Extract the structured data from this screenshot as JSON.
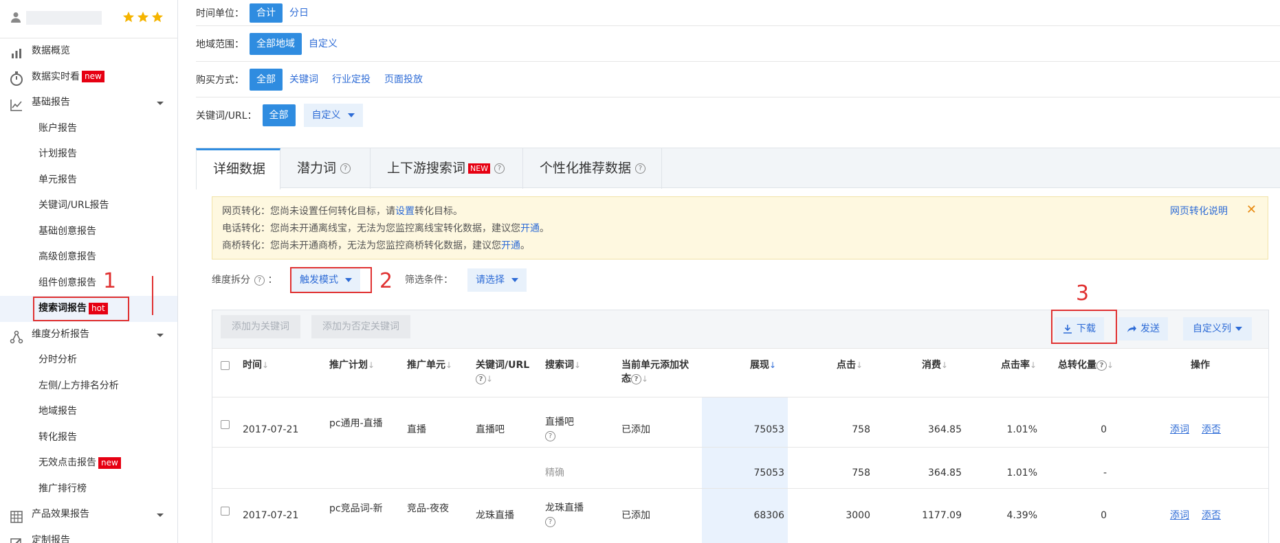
{
  "sidebar": {
    "stars": [
      "★",
      "★",
      "★"
    ],
    "items": [
      {
        "label": "数据概览",
        "icon": "bar-chart-icon"
      },
      {
        "label": "数据实时看",
        "icon": "stopwatch-icon",
        "tag": "new"
      },
      {
        "label": "基础报告",
        "icon": "line-chart-icon"
      },
      {
        "label": "账户报告"
      },
      {
        "label": "计划报告"
      },
      {
        "label": "单元报告"
      },
      {
        "label": "关键词/URL报告"
      },
      {
        "label": "基础创意报告"
      },
      {
        "label": "高级创意报告"
      },
      {
        "label": "组件创意报告"
      },
      {
        "label": "搜索词报告",
        "tag": "hot"
      },
      {
        "label": "维度分析报告",
        "icon": "network-icon"
      },
      {
        "label": "分时分析"
      },
      {
        "label": "左侧/上方排名分析"
      },
      {
        "label": "地域报告"
      },
      {
        "label": "转化报告"
      },
      {
        "label": "无效点击报告",
        "tag": "new"
      },
      {
        "label": "推广排行榜"
      },
      {
        "label": "产品效果报告",
        "icon": "grid-icon"
      },
      {
        "label": "定制报告",
        "icon": "edit-icon"
      }
    ]
  },
  "annotations": {
    "n1": "1",
    "n2": "2",
    "n3": "3"
  },
  "filters": {
    "time_label": "时间单位：",
    "time_opts": [
      "合计",
      "分日"
    ],
    "region_label": "地域范围：",
    "region_opts": [
      "全部地域",
      "自定义"
    ],
    "buy_label": "购买方式：",
    "buy_opts": [
      "全部",
      "关键词",
      "行业定投",
      "页面投放"
    ],
    "kw_label": "关键词/URL：",
    "kw_all": "全部",
    "kw_custom": "自定义"
  },
  "tabs": [
    {
      "label": "详细数据"
    },
    {
      "label": "潜力词"
    },
    {
      "label": "上下游搜索词",
      "tag": "NEW"
    },
    {
      "label": "个性化推荐数据"
    }
  ],
  "notice": {
    "line1_a": "网页转化：您尚未设置任何转化目标，请",
    "line1_link": "设置",
    "line1_b": "转化目标。",
    "line2_a": "电话转化：您尚未开通离线宝，无法为您监控离线宝转化数据，建议您",
    "line2_link": "开通",
    "line2_b": "。",
    "line3_a": "商桥转化：您尚未开通商桥，无法为您监控商桥转化数据，建议您",
    "line3_link": "开通",
    "line3_b": "。",
    "help": "网页转化说明",
    "close": "✕"
  },
  "dims": {
    "label": "维度拆分",
    "colon": "：",
    "select": "触发模式",
    "filter_label": "筛选条件：",
    "filter_select": "请选择"
  },
  "toolbar": {
    "add_kw": "添加为关键词",
    "add_neg": "添加为否定关键词",
    "download": "下载",
    "send": "发送",
    "custom_cols": "自定义列"
  },
  "columns": [
    "时间",
    "推广计划",
    "推广单元",
    "关键词/URL",
    "搜索词",
    "当前单元添加状",
    "态",
    "展现",
    "点击",
    "消费",
    "点击率",
    "总转化量",
    "操作"
  ],
  "rows": [
    {
      "date": "2017-07-21",
      "plan": "pc通用-直播",
      "unit": "直播",
      "kw": "直播吧",
      "term": "直播吧",
      "status": "已添加",
      "show": "75053",
      "click": "758",
      "cost": "364.85",
      "ctr": "1.01%",
      "conv": "0",
      "a1": "添词",
      "a2": "添否"
    },
    {
      "match": "精确",
      "show": "75053",
      "click": "758",
      "cost": "364.85",
      "ctr": "1.01%",
      "conv": "-"
    },
    {
      "date": "2017-07-21",
      "plan": "pc竞品词-新",
      "unit": "竞品-夜夜",
      "kw": "龙珠直播",
      "term": "龙珠直播",
      "status": "已添加",
      "show": "68306",
      "click": "3000",
      "cost": "1177.09",
      "ctr": "4.39%",
      "conv": "0",
      "a1": "添词",
      "a2": "添否"
    }
  ]
}
